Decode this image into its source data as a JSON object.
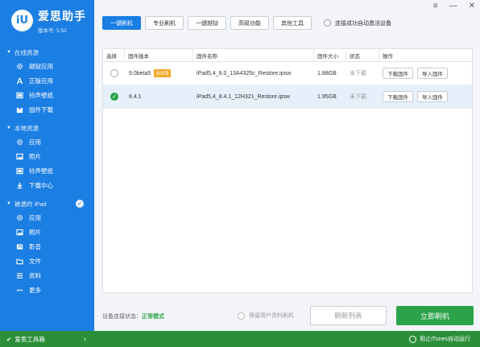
{
  "app": {
    "logo_text": "iU",
    "name": "爱思助手",
    "version": "版本号: 5.52"
  },
  "window_controls": {
    "menu": "≡",
    "minimize": "—",
    "close": "✕"
  },
  "sidebar": {
    "sections": [
      {
        "title": "在线资源",
        "items": [
          {
            "label": "越狱应用",
            "icon": "gear-icon"
          },
          {
            "label": "正版应用",
            "icon": "app-store-icon"
          },
          {
            "label": "铃声壁纸",
            "icon": "film-icon"
          },
          {
            "label": "固件下载",
            "icon": "box-icon"
          }
        ]
      },
      {
        "title": "本地资源",
        "items": [
          {
            "label": "应用",
            "icon": "gear-icon"
          },
          {
            "label": "照片",
            "icon": "photo-icon"
          },
          {
            "label": "铃声壁纸",
            "icon": "film-icon"
          },
          {
            "label": "下载中心",
            "icon": "download-icon"
          }
        ]
      },
      {
        "title": "被遗的 iPad",
        "items": [
          {
            "label": "应用",
            "icon": "gear-icon"
          },
          {
            "label": "照片",
            "icon": "photo-icon"
          },
          {
            "label": "影音",
            "icon": "music-icon"
          },
          {
            "label": "文件",
            "icon": "folder-icon"
          },
          {
            "label": "资料",
            "icon": "list-icon"
          },
          {
            "label": "更多",
            "icon": "more-icon"
          }
        ]
      }
    ],
    "footer_label": "爱思工具箱"
  },
  "tabs": [
    {
      "label": "一键刷机",
      "active": true
    },
    {
      "label": "专业刷机",
      "active": false
    },
    {
      "label": "一键越狱",
      "active": false
    },
    {
      "label": "高级功能",
      "active": false
    },
    {
      "label": "其他工具",
      "active": false
    }
  ],
  "auto_activate_label": "连接成功自动激活设备",
  "table": {
    "headers": [
      "选择",
      "固件版本",
      "固件名称",
      "固件大小",
      "状态",
      "操作"
    ],
    "rows": [
      {
        "selected": false,
        "version": "9.0beta5",
        "badge": "测试版",
        "name": "iPad5,4_9.0_13A4325c_Restore.ipsw",
        "size": "1.88GB",
        "status": "未下载",
        "action_download": "下载固件",
        "action_import": "导入固件"
      },
      {
        "selected": true,
        "version": "8.4.1",
        "badge": "",
        "name": "iPad5,4_8.4.1_12H321_Restore.ipsw",
        "size": "1.95GB",
        "status": "未下载",
        "action_download": "下载固件",
        "action_import": "导入固件"
      }
    ]
  },
  "footer": {
    "conn_label": "设备连接状态：",
    "conn_mode": "正常模式",
    "keep_data_label": "保留用户资料刷机",
    "refresh_label": "刷新列表",
    "flash_label": "立即刷机",
    "stop_itunes_label": "阻止iTunes自动运行"
  },
  "colors": {
    "primary": "#1b7ee3",
    "success": "#2aa34a",
    "beta_badge": "#f5a623"
  }
}
